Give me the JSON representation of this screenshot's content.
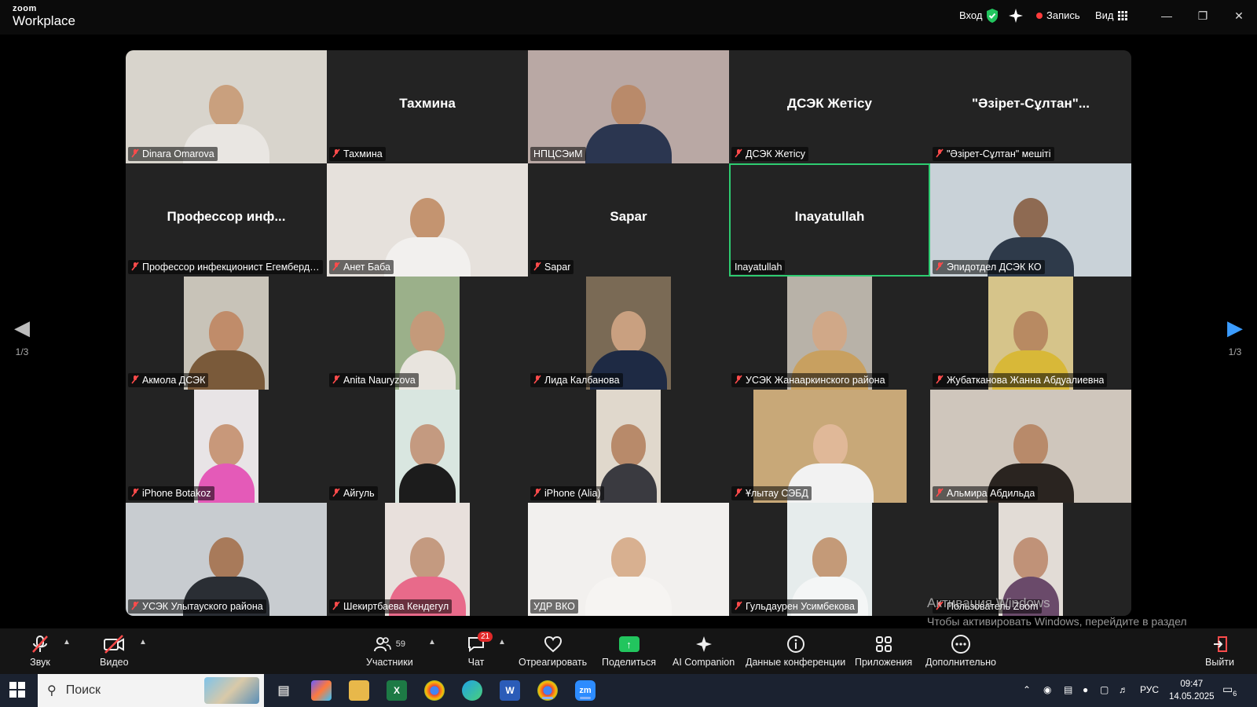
{
  "titlebar": {
    "brand_top": "zoom",
    "brand_bottom": "Workplace",
    "login": "Вход",
    "record": "Запись",
    "view": "Вид"
  },
  "gallery": {
    "page_indicator_left": "1/3",
    "page_indicator_right": "1/3",
    "tiles": [
      {
        "name": "Dinara Omarova",
        "display": "",
        "muted": true,
        "video": true,
        "bg": "#d8d4cc",
        "skin": "#c9a07e",
        "body": "#e9e6e2",
        "vw": 1,
        "active": false
      },
      {
        "name": "Тахмина",
        "display": "Тахмина",
        "muted": true,
        "video": false,
        "active": false
      },
      {
        "name": "НПЦСЭиМ",
        "display": "",
        "muted": false,
        "video": true,
        "bg": "#b9a8a4",
        "skin": "#b98a6a",
        "body": "#2b3650",
        "vw": 1,
        "active": false
      },
      {
        "name": "ДСЭК Жетісу",
        "display": "ДСЭК Жетісу",
        "muted": true,
        "video": false,
        "active": false
      },
      {
        "name": "\"Әзірет-Сұлтан\" мешіті",
        "display": "\"Әзірет-Сұлтан\"...",
        "muted": true,
        "video": false,
        "active": false
      },
      {
        "name": "Профессор инфекционист Егембердиева",
        "display": "Профессор инф...",
        "muted": true,
        "video": false,
        "active": false
      },
      {
        "name": "Анет Баба",
        "display": "",
        "muted": true,
        "video": true,
        "bg": "#e6e1dc",
        "skin": "#c49470",
        "body": "#f2f0ee",
        "vw": 1,
        "active": false
      },
      {
        "name": "Sapar",
        "display": "Sapar",
        "muted": true,
        "video": false,
        "active": false
      },
      {
        "name": "Inayatullah",
        "display": "Inayatullah",
        "muted": false,
        "video": false,
        "active": true
      },
      {
        "name": "Эпидотдел ДСЭК КО",
        "display": "",
        "muted": true,
        "video": true,
        "bg": "#c9d2d8",
        "skin": "#8e6a52",
        "body": "#2e3a4a",
        "vw": 1,
        "active": false
      },
      {
        "name": "Акмола ДСЭК",
        "display": "",
        "muted": true,
        "video": true,
        "bg": "#c8c3b8",
        "skin": "#c08c6a",
        "body": "#7a5a3a",
        "vw": 0.42,
        "active": false
      },
      {
        "name": "Anita Nauryzova",
        "display": "",
        "muted": true,
        "video": true,
        "bg": "#9bb08a",
        "skin": "#c49a7a",
        "body": "#e8e4de",
        "vw": 0.32,
        "active": false
      },
      {
        "name": "Лида Калбанова",
        "display": "",
        "muted": true,
        "video": true,
        "bg": "#7a6a55",
        "skin": "#c9a080",
        "body": "#1e2a44",
        "vw": 0.42,
        "active": false
      },
      {
        "name": "УСЭК Жанааркинского района",
        "display": "",
        "muted": true,
        "video": true,
        "bg": "#b8b2a8",
        "skin": "#d0a888",
        "body": "#c8a060",
        "vw": 0.42,
        "active": false
      },
      {
        "name": "Жубатканова Жанна Абдуалиевна",
        "display": "",
        "muted": true,
        "video": true,
        "bg": "#d6c48a",
        "skin": "#b88a62",
        "body": "#d8b838",
        "vw": 0.42,
        "active": false
      },
      {
        "name": "iPhone Botakoz",
        "display": "",
        "muted": true,
        "video": true,
        "bg": "#e8e4e6",
        "skin": "#c8987a",
        "body": "#e45ab8",
        "vw": 0.32,
        "active": false
      },
      {
        "name": "Айгуль",
        "display": "",
        "muted": true,
        "video": true,
        "bg": "#d9e6e0",
        "skin": "#c49a80",
        "body": "#1c1c1c",
        "vw": 0.32,
        "active": false
      },
      {
        "name": "iPhone (Alia)",
        "display": "",
        "muted": true,
        "video": true,
        "bg": "#e0d8cc",
        "skin": "#b88a6a",
        "body": "#3a3a40",
        "vw": 0.32,
        "active": false
      },
      {
        "name": "Ұлытау СЭБД",
        "display": "",
        "muted": true,
        "video": true,
        "bg": "#c8a878",
        "skin": "#e0b898",
        "body": "#f2f2f2",
        "vw": 0.76,
        "active": false
      },
      {
        "name": "Альмира Абдильда",
        "display": "",
        "muted": true,
        "video": true,
        "bg": "#cfc6bc",
        "skin": "#b88a6a",
        "body": "#2a2420",
        "vw": 1,
        "active": false
      },
      {
        "name": "УСЭК Улытауского района",
        "display": "",
        "muted": true,
        "video": true,
        "bg": "#c8ccd0",
        "skin": "#a87a5a",
        "body": "#2a2e34",
        "vw": 1,
        "active": false
      },
      {
        "name": "Шекиртбаева Кендегул",
        "display": "",
        "muted": true,
        "video": true,
        "bg": "#e8e0dc",
        "skin": "#c49a80",
        "body": "#e86a8a",
        "vw": 0.42,
        "active": false
      },
      {
        "name": "УДР ВКО",
        "display": "",
        "muted": false,
        "video": true,
        "bg": "#f2f0ee",
        "skin": "#d8b090",
        "body": "#f6f4f2",
        "vw": 1,
        "active": false
      },
      {
        "name": "Гульдаурен Усимбекова",
        "display": "",
        "muted": true,
        "video": true,
        "bg": "#e6ecec",
        "skin": "#c49a78",
        "body": "#f4f6f6",
        "vw": 0.42,
        "active": false
      },
      {
        "name": "Пользователь Zoom",
        "display": "",
        "muted": true,
        "video": true,
        "bg": "#e2dcd6",
        "skin": "#c09278",
        "body": "#6a4a6a",
        "vw": 0.32,
        "active": false
      }
    ]
  },
  "activation": {
    "title": "Активация Windows",
    "text": "Чтобы активировать Windows, перейдите в раздел \"Параметры\"."
  },
  "toolbar": {
    "audio": "Звук",
    "video": "Видео",
    "participants": "Участники",
    "participants_count": "59",
    "chat": "Чат",
    "chat_badge": "21",
    "react": "Отреагировать",
    "share": "Поделиться",
    "ai": "AI Companion",
    "meeting_info": "Данные конференции",
    "apps": "Приложения",
    "more": "Дополнительно",
    "leave": "Выйти"
  },
  "taskbar": {
    "search_placeholder": "Поиск",
    "lang": "РУС",
    "time": "09:47",
    "date": "14.05.2025",
    "notif_count": "6"
  },
  "colors": {
    "active_speaker": "#2ecc71",
    "mute_red": "#ff4b4b",
    "share_green": "#22c55e"
  }
}
